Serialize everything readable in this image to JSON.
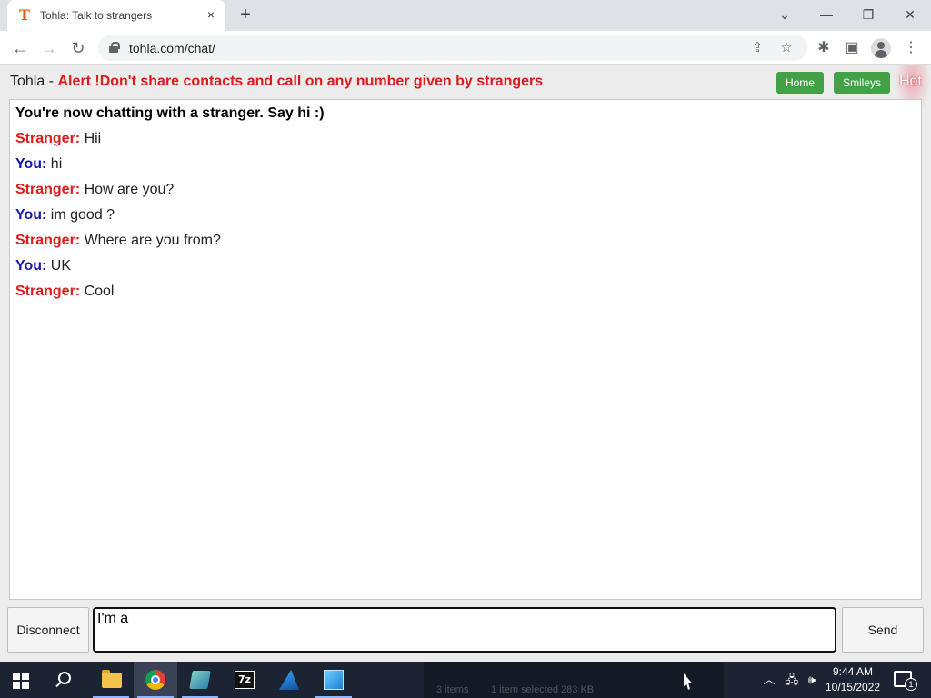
{
  "browser": {
    "tab": {
      "favicon": "T",
      "title": "Tohla: Talk to strangers",
      "close_icon": "×"
    },
    "new_tab_icon": "+",
    "window_controls": {
      "tab_search": "⌄",
      "minimize": "—",
      "restore": "❐",
      "close": "✕"
    },
    "nav": {
      "back": "←",
      "forward": "→",
      "reload": "↻"
    },
    "url": "tohla.com/chat/",
    "omnibox_icons": {
      "share": "⇪",
      "bookmark": "☆"
    },
    "toolbar_icons": {
      "extensions": "✱",
      "side_panel": "▣",
      "menu": "⋮"
    }
  },
  "page": {
    "brand": "Tohla",
    "separator": " - ",
    "alert": "Alert !Don't share contacts and call on any number given by strangers",
    "home_button": "Home",
    "smileys_button": "Smileys",
    "hot_label": "Hot"
  },
  "chat": {
    "intro": "You're now chatting with a stranger. Say hi :)",
    "messages": [
      {
        "who": "Stranger:",
        "text": " Hii"
      },
      {
        "who": "You:",
        "text": " hi"
      },
      {
        "who": "Stranger:",
        "text": " How are you?"
      },
      {
        "who": "You:",
        "text": " im good ?"
      },
      {
        "who": "Stranger:",
        "text": " Where are you from?"
      },
      {
        "who": "You:",
        "text": " UK"
      },
      {
        "who": "Stranger:",
        "text": " Cool"
      }
    ]
  },
  "composer": {
    "disconnect_label": "Disconnect",
    "input_value": "I'm a",
    "send_label": "Send"
  },
  "taskbar": {
    "apps": [
      "windows-start",
      "search",
      "file-explorer",
      "chrome",
      "app-notepad",
      "7-zip",
      "app-shark",
      "app-window"
    ],
    "peek_items": "3 items",
    "peek_selected": "1 item selected  283 KB",
    "tray": {
      "chevron": "︿",
      "network": "🖧",
      "volume": "🕪"
    },
    "time": "9:44 AM",
    "date": "10/15/2022",
    "notification_count": "1"
  },
  "colors": {
    "alert_red": "#e01b1b",
    "you_blue": "#1616b0",
    "button_green": "#43a047",
    "taskbar": "#1c2433"
  }
}
